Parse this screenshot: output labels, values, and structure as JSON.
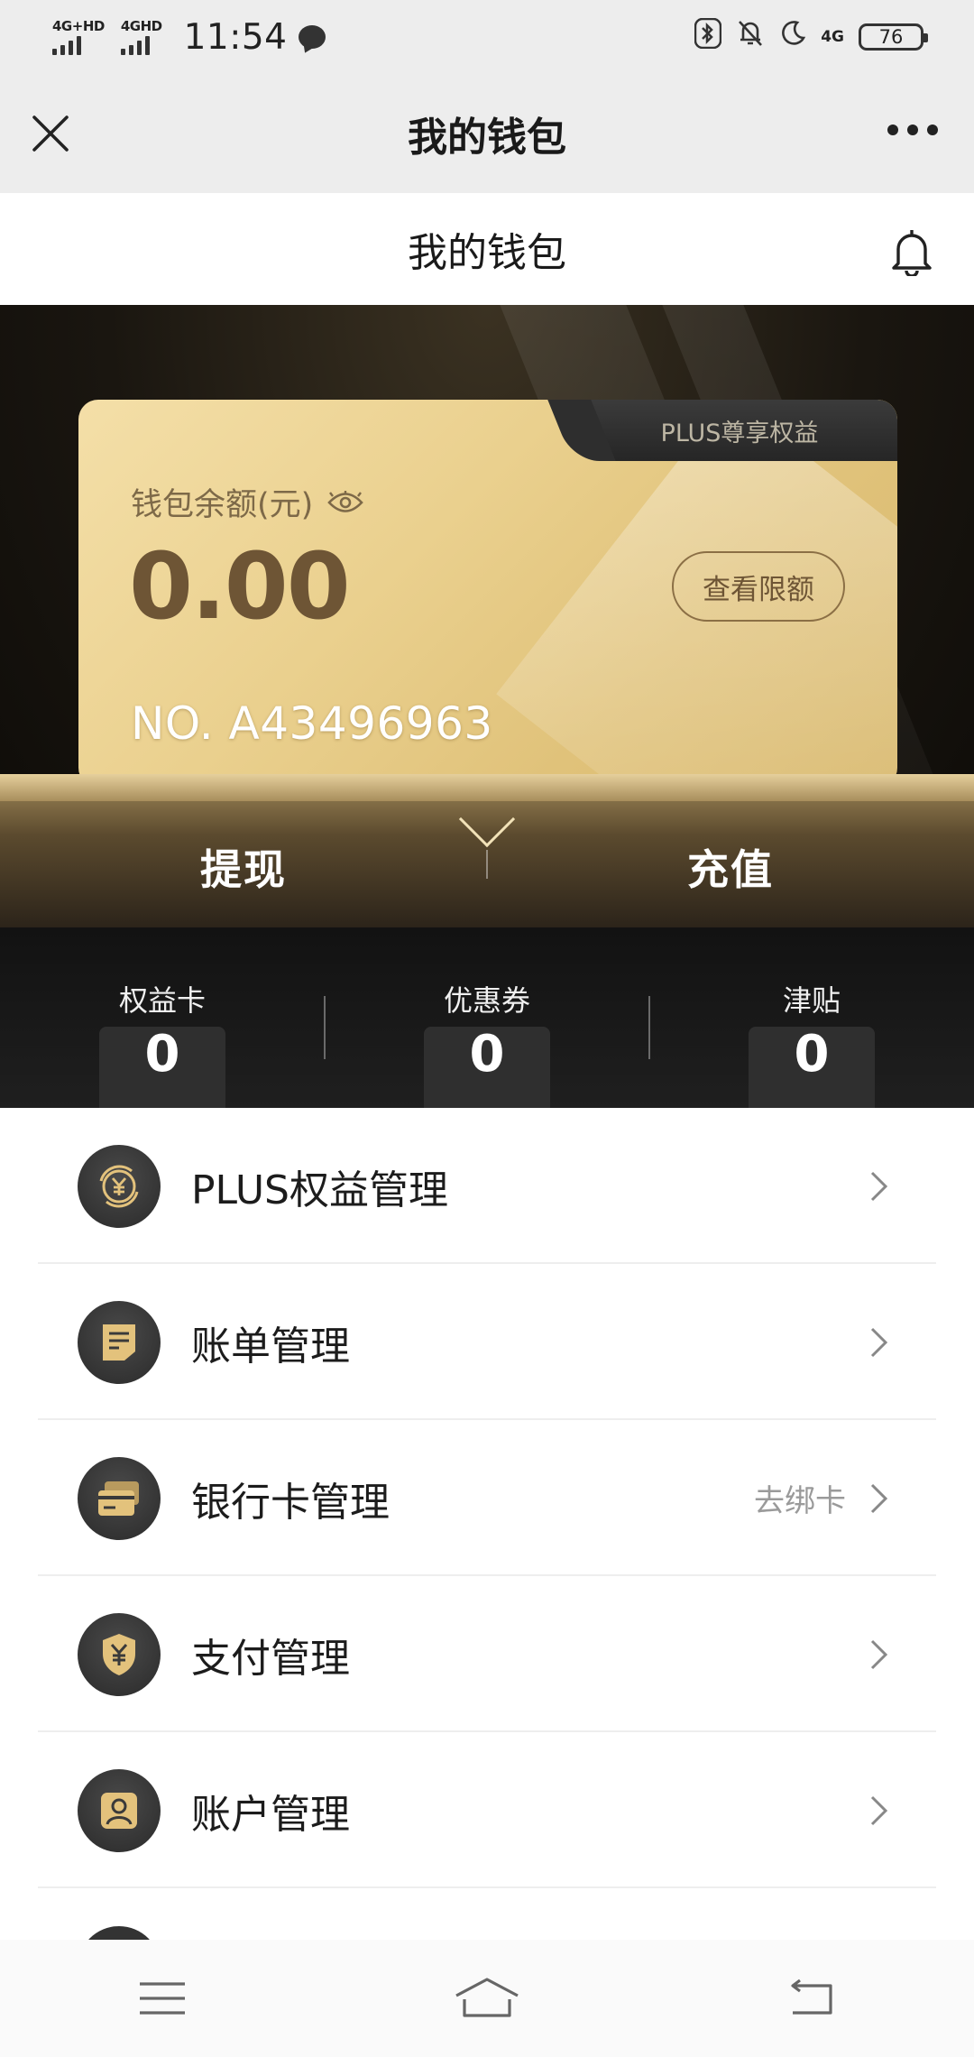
{
  "status_bar": {
    "signal1_label": "4G+HD",
    "signal2_label": "4GHD",
    "time": "11:54",
    "network_label": "4G",
    "battery_level": "76"
  },
  "title_bar": {
    "title": "我的钱包"
  },
  "page_header": {
    "title": "我的钱包"
  },
  "wallet_card": {
    "tab_label": "PLUS尊享权益",
    "balance_label": "钱包余额(元)",
    "balance": "0.00",
    "limit_button": "查看限额",
    "card_number": "NO. A43496963"
  },
  "actions": {
    "withdraw": "提现",
    "recharge": "充值"
  },
  "stats": [
    {
      "label": "权益卡",
      "value": "0"
    },
    {
      "label": "优惠券",
      "value": "0"
    },
    {
      "label": "津贴",
      "value": "0"
    }
  ],
  "menu": [
    {
      "label": "PLUS权益管理",
      "extra": "",
      "icon": "plus-benefit-icon"
    },
    {
      "label": "账单管理",
      "extra": "",
      "icon": "bill-icon"
    },
    {
      "label": "银行卡管理",
      "extra": "去绑卡",
      "icon": "bank-card-icon"
    },
    {
      "label": "支付管理",
      "extra": "",
      "icon": "payment-shield-icon"
    },
    {
      "label": "账户管理",
      "extra": "",
      "icon": "account-icon"
    }
  ],
  "colors": {
    "gold_light": "#f4dfa8",
    "gold_dark": "#6e5535",
    "dark_bg": "#1a1610",
    "icon_gold": "#e3c27c"
  }
}
